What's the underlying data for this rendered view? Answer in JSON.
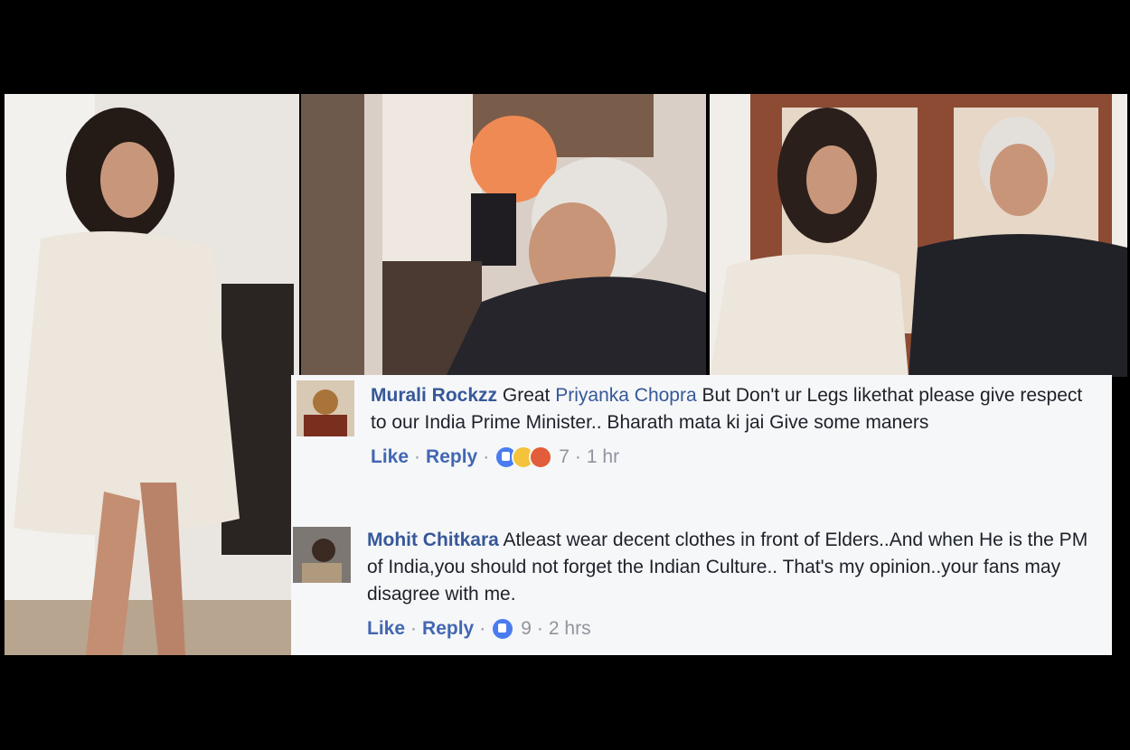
{
  "comments": [
    {
      "author": "Murali Rockzz",
      "text_before_mention": " Great ",
      "mention": "Priyanka Chopra",
      "text_after_mention": " But Don't ur Legs likethat please give respect to our India Prime Minister.. Bharath mata ki jai Give some maners",
      "like_label": "Like",
      "reply_label": "Reply",
      "reaction_count": "7",
      "time": "1 hr",
      "reactions": [
        "like-icon",
        "haha-icon",
        "angry-icon"
      ]
    },
    {
      "author": "Mohit Chitkara",
      "text": " Atleast wear decent clothes in front of Elders..And when He is the PM of India,you should not forget the Indian Culture.. That's my opinion..your fans may disagree with me.",
      "like_label": "Like",
      "reply_label": "Reply",
      "reaction_count": "9",
      "time": "2 hrs",
      "reactions": [
        "like-icon"
      ]
    }
  ],
  "colors": {
    "link": "#365899",
    "meta": "#90949c",
    "panel": "#f6f7f9"
  }
}
